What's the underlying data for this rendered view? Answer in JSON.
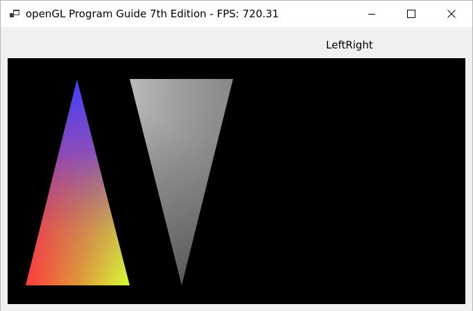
{
  "window": {
    "title": "openGL Program Guide 7th Edition - FPS: 720.31",
    "controls": {
      "minimize_icon": "minimize-icon",
      "maximize_icon": "maximize-icon",
      "close_icon": "close-icon"
    }
  },
  "toolbar": {
    "label": "LeftRight"
  },
  "viewport": {
    "background": "#000000",
    "left_triangle_colors": {
      "top": "#4040ff",
      "bottom_left": "#ff3a3a",
      "bottom_right": "#d6ff33"
    },
    "right_triangle_colors": {
      "top_left": "#c0c0c0",
      "top_right": "#7a7a7a",
      "bottom": "#5a5a5a"
    }
  }
}
